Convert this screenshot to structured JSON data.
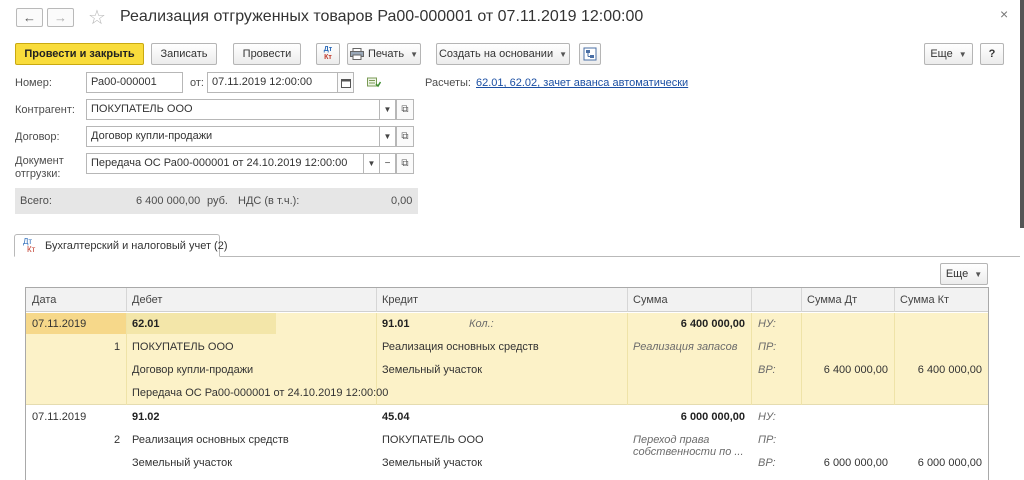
{
  "window": {
    "title": "Реализация отгруженных товаров Ра00-000001 от 07.11.2019 12:00:00",
    "back_glyph": "←",
    "forward_glyph": "→",
    "star_glyph": "☆",
    "close_glyph": "×"
  },
  "toolbar": {
    "post_and_close": "Провести и закрыть",
    "save": "Записать",
    "post": "Провести",
    "dt_kt_top": "Дт",
    "dt_kt_bottom": "Кт",
    "print": "Печать",
    "create_based_on": "Создать на основании",
    "more": "Еще",
    "help": "?"
  },
  "form": {
    "number_label": "Номер:",
    "number_value": "Ра00-000001",
    "date_label": "от:",
    "date_value": "07.11.2019 12:00:00",
    "settlements_label": "Расчеты:",
    "settlements_link": "62.01, 62.02, зачет аванса автоматически",
    "counterparty_label": "Контрагент:",
    "counterparty_value": "ПОКУПАТЕЛЬ ООО",
    "contract_label": "Договор:",
    "contract_value": "Договор купли-продажи",
    "shipment_label_1": "Документ",
    "shipment_label_2": "отгрузки:",
    "shipment_value": "Передача ОС Ра00-000001 от 24.10.2019 12:00:00"
  },
  "totals": {
    "total_label": "Всего:",
    "total_value": "6 400 000,00",
    "currency": "руб.",
    "vat_label": "НДС (в т.ч.):",
    "vat_value": "0,00"
  },
  "tab": {
    "label": "Бухгалтерский и налоговый учет (2)"
  },
  "grid_toolbar": {
    "more": "Еще"
  },
  "grid": {
    "columns": {
      "date": "Дата",
      "debit": "Дебет",
      "credit": "Кредит",
      "sum": "Сумма",
      "sum_dt": "Сумма Дт",
      "sum_kt": "Сумма Кт"
    },
    "entries": [
      {
        "date": "07.11.2019",
        "line_no": "1",
        "debit_account": "62.01",
        "debit_sub1": "ПОКУПАТЕЛЬ ООО",
        "debit_sub2": "Договор купли-продажи",
        "debit_sub3": "Передача ОС Ра00-000001 от 24.10.2019 12:00:00",
        "credit_account": "91.01",
        "qty_label": "Кол.:",
        "credit_sub1": "Реализация основных средств",
        "credit_sub2": "Земельный участок",
        "sum": "6 400 000,00",
        "comment_1": "Реализация запасов",
        "comment_2": "",
        "nu_label": "НУ:",
        "pr_label": "ПР:",
        "vr_label": "ВР:",
        "sum_dt_vr": "6 400 000,00",
        "sum_kt_vr": "6 400 000,00"
      },
      {
        "date": "07.11.2019",
        "line_no": "2",
        "debit_account": "91.02",
        "debit_sub1": "Реализация основных средств",
        "debit_sub2": "Земельный участок",
        "credit_account": "45.04",
        "credit_sub1": "ПОКУПАТЕЛЬ ООО",
        "credit_sub2": "Земельный участок",
        "sum": "6 000 000,00",
        "comment_1": "Переход права",
        "comment_2": "собственности по ...",
        "nu_label": "НУ:",
        "pr_label": "ПР:",
        "vr_label": "ВР:",
        "sum_dt_vr": "6 000 000,00",
        "sum_kt_vr": "6 000 000,00"
      }
    ]
  },
  "colors": {
    "primary_button": "#f9dc3b",
    "selected_row": "#fcf2c8",
    "link": "#1b4fa3"
  }
}
